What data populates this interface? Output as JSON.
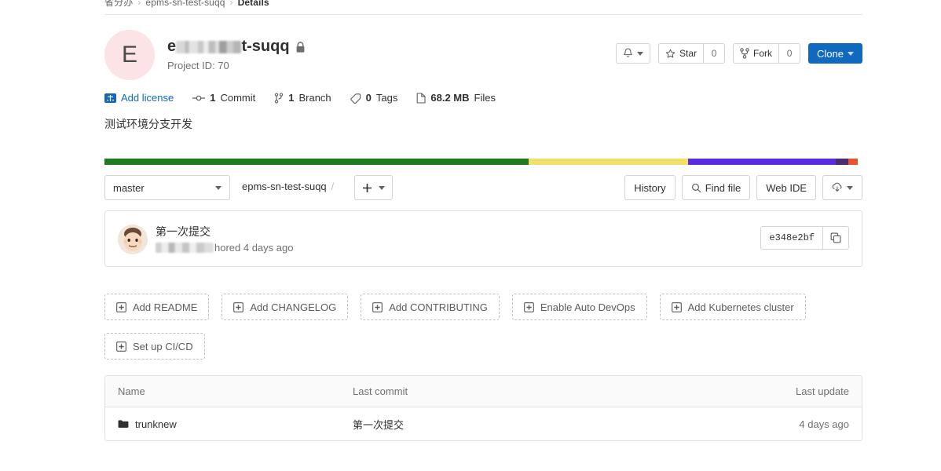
{
  "breadcrumb": {
    "group": "省分办",
    "project": "epms-sn-test-suqq",
    "current": "Details",
    "separator": "›"
  },
  "project_header": {
    "avatar_letter": "E",
    "avatar_color": "#fce3e5",
    "name_prefix": "e",
    "name_suffix": "t-suqq",
    "visibility_icon": "lock-icon",
    "project_id_label": "Project ID: 70"
  },
  "header_actions": {
    "notification_icon": "bell-icon",
    "star_label": "Star",
    "star_count": "0",
    "fork_label": "Fork",
    "fork_count": "0",
    "clone_label": "Clone"
  },
  "stats": [
    {
      "icon": "license-icon",
      "text": "Add license",
      "link": true
    },
    {
      "icon": "commit-icon",
      "value": "1",
      "unit": "Commit"
    },
    {
      "icon": "branch-icon",
      "value": "1",
      "unit": "Branch"
    },
    {
      "icon": "tag-icon",
      "value": "0",
      "unit": "Tags"
    },
    {
      "icon": "file-icon",
      "value": "68.2 MB",
      "unit": "Files"
    }
  ],
  "description": "测试环境分支开发",
  "language_bar": [
    {
      "name": "green",
      "color": "#1f7a1f",
      "pct": 56.0
    },
    {
      "name": "yellow",
      "color": "#f0e06a",
      "pct": 21.0
    },
    {
      "name": "purple",
      "color": "#5b2be0",
      "pct": 19.5
    },
    {
      "name": "dark-purple",
      "color": "#4b2d6e",
      "pct": 1.6
    },
    {
      "name": "orange",
      "color": "#e8552c",
      "pct": 1.3
    }
  ],
  "repo_nav": {
    "branch": "master",
    "path_root": "epms-sn-test-suqq",
    "path_separator": "/",
    "plus_icon": "plus-icon",
    "history_label": "History",
    "find_file_label": "Find file",
    "find_file_icon": "search-icon",
    "web_ide_label": "Web IDE",
    "download_icon": "download-archive-icon"
  },
  "commit": {
    "message": "第一次提交",
    "author_suffix": "hored 4 days ago",
    "sha": "e348e2bf",
    "copy_icon": "copy-icon"
  },
  "quick_actions_row1": [
    {
      "icon": "plus-square-icon",
      "label": "Add README"
    },
    {
      "icon": "plus-square-icon",
      "label": "Add CHANGELOG"
    },
    {
      "icon": "plus-square-icon",
      "label": "Add CONTRIBUTING"
    },
    {
      "icon": "plus-square-icon",
      "label": "Enable Auto DevOps"
    },
    {
      "icon": "plus-square-icon",
      "label": "Add Kubernetes cluster"
    }
  ],
  "quick_actions_row2": [
    {
      "icon": "plus-square-icon",
      "label": "Set up CI/CD"
    }
  ],
  "file_tree": {
    "columns": {
      "name": "Name",
      "last_commit": "Last commit",
      "last_update": "Last update"
    },
    "rows": [
      {
        "icon": "folder-icon",
        "name": "trunknew",
        "last_commit": "第一次提交",
        "last_update": "4 days ago"
      }
    ]
  }
}
